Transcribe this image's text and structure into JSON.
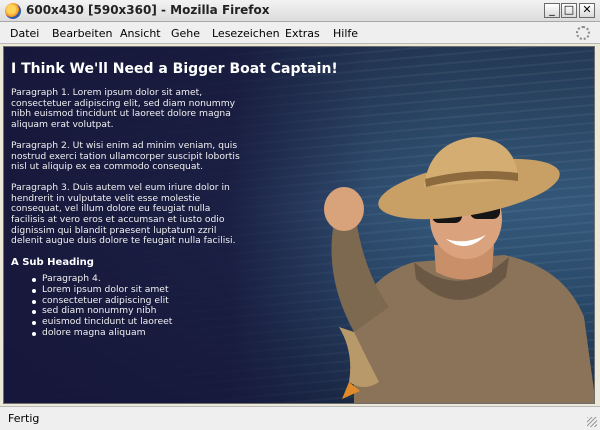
{
  "window": {
    "title": "600x430 [590x360] - Mozilla Firefox",
    "minimize_label": "_",
    "maximize_label": "□",
    "close_label": "✕"
  },
  "menu": {
    "items": [
      "Datei",
      "Bearbeiten",
      "Ansicht",
      "Gehe",
      "Lesezeichen",
      "Extras",
      "Hilfe"
    ]
  },
  "page": {
    "title": "I Think We'll Need a Bigger Boat Captain!",
    "paragraphs": [
      "Paragraph 1. Lorem ipsum dolor sit amet, consectetuer adipiscing elit, sed diam nonummy nibh euismod tincidunt ut laoreet dolore magna aliquam erat volutpat.",
      "Paragraph 2. Ut wisi enim ad minim veniam, quis nostrud exerci tation ullamcorper suscipit lobortis nisl ut aliquip ex ea commodo consequat.",
      "Paragraph 3. Duis autem vel eum iriure dolor in hendrerit in vulputate velit esse molestie consequat, vel illum dolore eu feugiat nulla facilisis at vero eros et accumsan et iusto odio dignissim qui blandit praesent luptatum zzril delenit augue duis dolore te feugait nulla facilisi."
    ],
    "sub_heading": "A Sub Heading",
    "bullets": [
      "Paragraph 4.",
      "Lorem ipsum dolor sit amet",
      "consectetuer adipiscing elit",
      "sed diam nonummy nibh",
      "euismod tincidunt ut laoreet",
      "dolore magna aliquam"
    ]
  },
  "status": {
    "text": "Fertig"
  },
  "icons": {
    "app": "firefox-icon",
    "throbber": "loading-throbber-icon",
    "grip": "resize-grip-icon"
  }
}
